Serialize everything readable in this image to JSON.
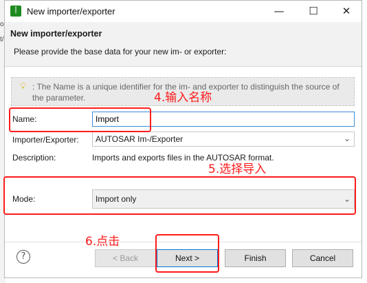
{
  "window": {
    "title": "New importer/exporter",
    "icon_glyph": "꒐"
  },
  "controls": {
    "minimize": "—",
    "maximize": "☐",
    "close": "✕"
  },
  "header": {
    "title": "New importer/exporter",
    "description": "Please provide the base data for your new im- or exporter:"
  },
  "hint": {
    "icon": "lightbulb-icon",
    "text": ": The Name is a unique identifier for the im- and exporter to distinguish the source of the parameter."
  },
  "form": {
    "name_label": "Name:",
    "name_value": "Import",
    "type_label": "Importer/Exporter:",
    "type_value": "AUTOSAR Im-/Exporter",
    "desc_label": "Description:",
    "desc_value": "Imports and exports files in the AUTOSAR format.",
    "mode_label": "Mode:",
    "mode_value": "Import only"
  },
  "buttons": {
    "help": "?",
    "back": "< Back",
    "next": "Next >",
    "finish": "Finish",
    "cancel": "Cancel"
  },
  "annotations": {
    "step4": "4.输入名称",
    "step5": "5.选择导入",
    "step6": "6.点击",
    "color": "#ff1a1a"
  },
  "bg": {
    "line1": "or",
    "line2": "t/"
  }
}
